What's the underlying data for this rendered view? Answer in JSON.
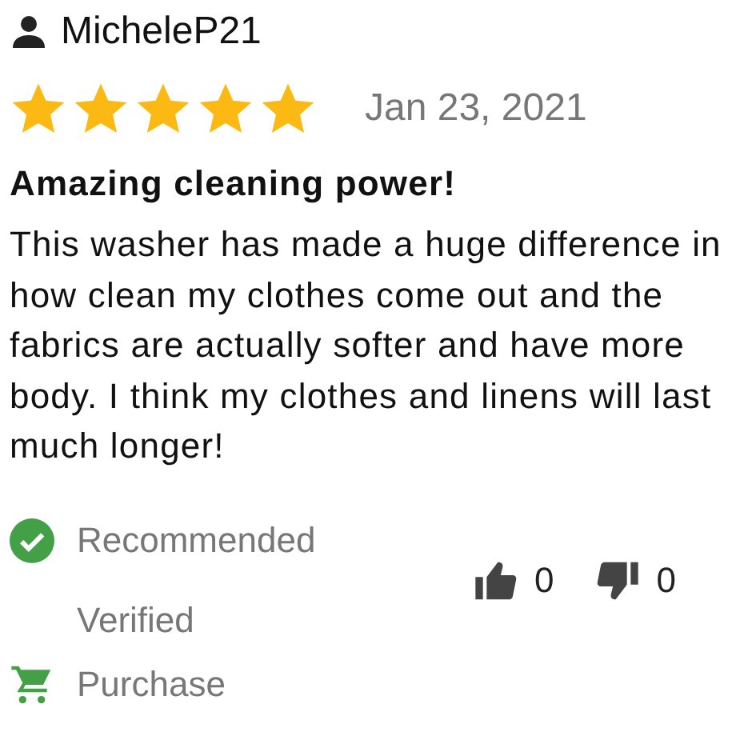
{
  "review": {
    "author": "MicheleP21",
    "stars": 5,
    "date": "Jan 23, 2021",
    "title": "Amazing cleaning power!",
    "body": "This washer has made a huge difference in how clean my clothes come out and the fabrics are actually softer and have more body. I think my clothes and linens will last much longer!",
    "badges": [
      {
        "kind": "recommended",
        "label": "Recommended"
      },
      {
        "kind": "verified",
        "label": "Verified Purchase"
      }
    ],
    "votes": {
      "up": "0",
      "down": "0"
    }
  }
}
